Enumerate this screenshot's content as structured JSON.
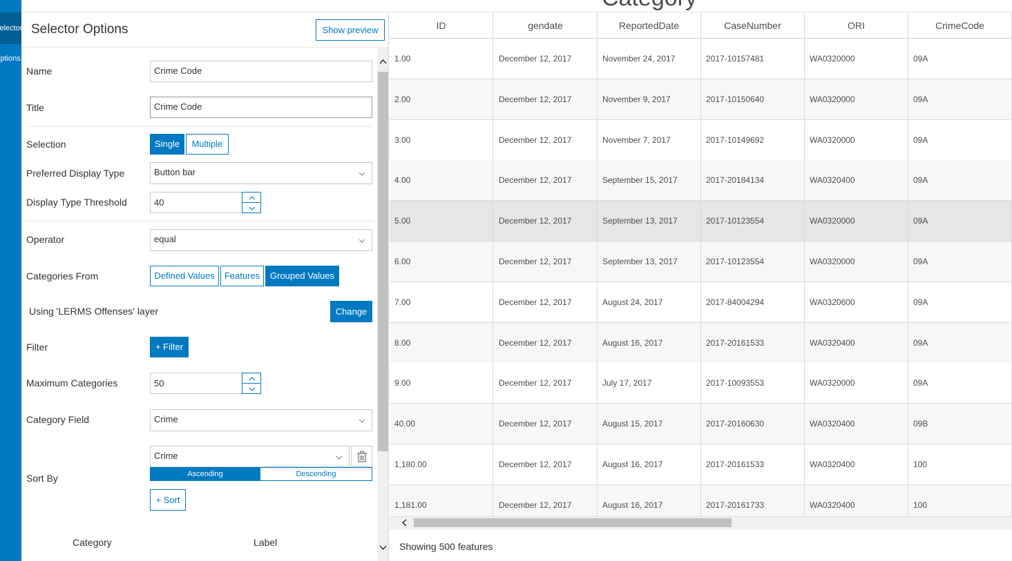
{
  "nav": {
    "item_selector": "Selector",
    "item_options": "Options"
  },
  "page_title_clipped": "Category",
  "panel": {
    "title": "Selector Options",
    "show_preview": "Show preview",
    "name_label": "Name",
    "name_value": "Crime Code",
    "title_label": "Title",
    "title_value": "Crime Code",
    "selection_label": "Selection",
    "selection_single": "Single",
    "selection_multiple": "Multiple",
    "display_type_label": "Preferred Display Type",
    "display_type_value": "Button bar",
    "threshold_label": "Display Type Threshold",
    "threshold_value": "40",
    "operator_label": "Operator",
    "operator_value": "equal",
    "categories_from_label": "Categories From",
    "cat_defined": "Defined Values",
    "cat_features": "Features",
    "cat_grouped": "Grouped Values",
    "layer_text": "Using 'LERMS Offenses' layer",
    "change_button": "Change",
    "filter_label": "Filter",
    "filter_button": "+ Filter",
    "max_categories_label": "Maximum Categories",
    "max_categories_value": "50",
    "category_field_label": "Category Field",
    "category_field_value": "Crime",
    "sort_by_label": "Sort By",
    "sort_field_value": "Crime",
    "sort_ascending": "Ascending",
    "sort_descending": "Descending",
    "add_sort_button": "+ Sort",
    "col_category": "Category",
    "col_label": "Label"
  },
  "table": {
    "columns": [
      "ID",
      "gendate",
      "ReportedDate",
      "CaseNumber",
      "ORI",
      "CrimeCode"
    ],
    "rows": [
      [
        "1.00",
        "December 12, 2017",
        "November 24, 2017",
        "2017-10157481",
        "WA0320000",
        "09A"
      ],
      [
        "2.00",
        "December 12, 2017",
        "November 9, 2017",
        "2017-10150640",
        "WA0320000",
        "09A"
      ],
      [
        "3.00",
        "December 12, 2017",
        "November 7, 2017",
        "2017-10149692",
        "WA0320000",
        "09A"
      ],
      [
        "4.00",
        "December 12, 2017",
        "September 15, 2017",
        "2017-20184134",
        "WA0320400",
        "09A"
      ],
      [
        "5.00",
        "December 12, 2017",
        "September 13, 2017",
        "2017-10123554",
        "WA0320000",
        "09A"
      ],
      [
        "6.00",
        "December 12, 2017",
        "September 13, 2017",
        "2017-10123554",
        "WA0320000",
        "09A"
      ],
      [
        "7.00",
        "December 12, 2017",
        "August 24, 2017",
        "2017-84004294",
        "WA0320600",
        "09A"
      ],
      [
        "8.00",
        "December 12, 2017",
        "August 16, 2017",
        "2017-20161533",
        "WA0320400",
        "09A"
      ],
      [
        "9.00",
        "December 12, 2017",
        "July 17, 2017",
        "2017-10093553",
        "WA0320000",
        "09A"
      ],
      [
        "40.00",
        "December 12, 2017",
        "August 15, 2017",
        "2017-20160630",
        "WA0320400",
        "09B"
      ],
      [
        "1,180.00",
        "December 12, 2017",
        "August 16, 2017",
        "2017-20161533",
        "WA0320400",
        "100"
      ],
      [
        "1,181.00",
        "December 12, 2017",
        "August 16, 2017",
        "2017-20161733",
        "WA0320400",
        "100"
      ]
    ],
    "highlighted_row": 4,
    "footer": "Showing 500 features"
  },
  "colors": {
    "accent": "#0079c1",
    "row_alt": "#f7f7f7",
    "row_highlight": "#e6e6e6"
  }
}
